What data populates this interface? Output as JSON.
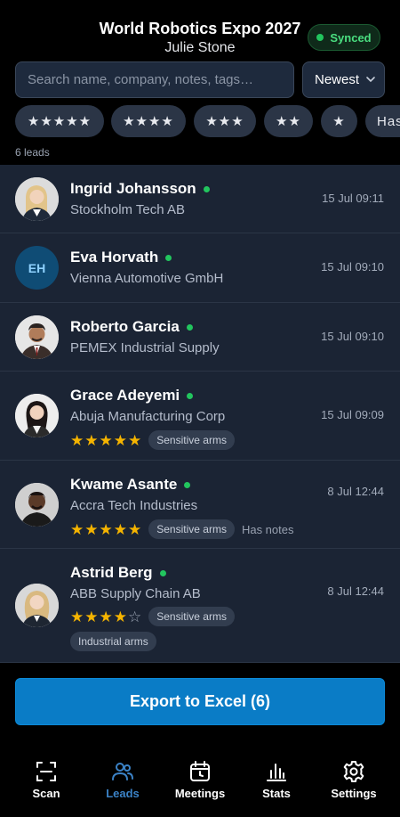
{
  "header": {
    "title": "World Robotics Expo 2027",
    "subtitle": "Julie Stone",
    "sync_status": "Synced"
  },
  "search": {
    "placeholder": "Search name, company, notes, tags…",
    "value": ""
  },
  "sort": {
    "selected": "Newest"
  },
  "filters": [
    {
      "label": "★★★★★"
    },
    {
      "label": "★★★★"
    },
    {
      "label": "★★★"
    },
    {
      "label": "★★"
    },
    {
      "label": "★"
    },
    {
      "label": "Has"
    }
  ],
  "lead_count": "6 leads",
  "leads": [
    {
      "name": "Ingrid Johansson",
      "company": "Stockholm Tech AB",
      "time": "15 Jul 09:11",
      "avatar": "photo",
      "rating": 0,
      "tags": [],
      "notes": ""
    },
    {
      "name": "Eva Horvath",
      "company": "Vienna Automotive GmbH",
      "time": "15 Jul 09:10",
      "avatar": "EH",
      "rating": 0,
      "tags": [],
      "notes": ""
    },
    {
      "name": "Roberto Garcia",
      "company": "PEMEX Industrial Supply",
      "time": "15 Jul 09:10",
      "avatar": "photo",
      "rating": 0,
      "tags": [],
      "notes": ""
    },
    {
      "name": "Grace Adeyemi",
      "company": "Abuja Manufacturing Corp",
      "time": "15 Jul 09:09",
      "avatar": "photo",
      "rating": 5,
      "tags": [
        "Sensitive arms"
      ],
      "notes": ""
    },
    {
      "name": "Kwame Asante",
      "company": "Accra Tech Industries",
      "time": "8 Jul 12:44",
      "avatar": "photo",
      "rating": 5,
      "tags": [
        "Sensitive arms"
      ],
      "notes": "Has notes"
    },
    {
      "name": "Astrid Berg",
      "company": "ABB Supply Chain AB",
      "time": "8 Jul 12:44",
      "avatar": "photo",
      "rating": 4,
      "tags": [
        "Sensitive arms",
        "Industrial arms"
      ],
      "notes": ""
    }
  ],
  "export_label": "Export to Excel (6)",
  "nav": [
    {
      "label": "Scan",
      "icon": "scan-icon",
      "active": false
    },
    {
      "label": "Leads",
      "icon": "users-icon",
      "active": true
    },
    {
      "label": "Meetings",
      "icon": "calendar-icon",
      "active": false
    },
    {
      "label": "Stats",
      "icon": "bar-chart-icon",
      "active": false
    },
    {
      "label": "Settings",
      "icon": "gear-icon",
      "active": false
    }
  ],
  "colors": {
    "accent": "#0a7cc6",
    "active_nav": "#3b82c6",
    "star": "#f5b400",
    "online": "#22c55e"
  }
}
